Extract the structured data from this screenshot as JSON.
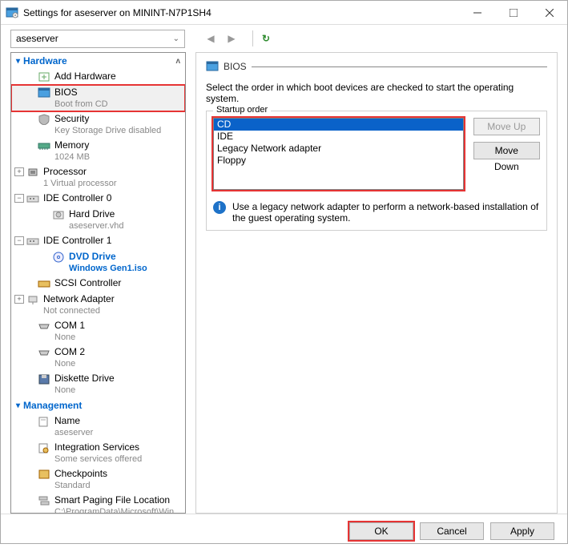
{
  "window": {
    "title": "Settings for aseserver on MININT-N7P1SH4"
  },
  "toolbar": {
    "vm_name": "aseserver"
  },
  "tree": {
    "hardware_label": "Hardware",
    "management_label": "Management",
    "add_hardware": "Add Hardware",
    "bios": {
      "label": "BIOS",
      "sub": "Boot from CD"
    },
    "security": {
      "label": "Security",
      "sub": "Key Storage Drive disabled"
    },
    "memory": {
      "label": "Memory",
      "sub": "1024 MB"
    },
    "processor": {
      "label": "Processor",
      "sub": "1 Virtual processor"
    },
    "ide0": {
      "label": "IDE Controller 0"
    },
    "hard_drive": {
      "label": "Hard Drive",
      "sub": "aseserver.vhd"
    },
    "ide1": {
      "label": "IDE Controller 1"
    },
    "dvd": {
      "label": "DVD Drive",
      "sub": "Windows Gen1.iso"
    },
    "scsi": {
      "label": "SCSI Controller"
    },
    "net": {
      "label": "Network Adapter",
      "sub": "Not connected"
    },
    "com1": {
      "label": "COM 1",
      "sub": "None"
    },
    "com2": {
      "label": "COM 2",
      "sub": "None"
    },
    "diskette": {
      "label": "Diskette Drive",
      "sub": "None"
    },
    "name": {
      "label": "Name",
      "sub": "aseserver"
    },
    "integration": {
      "label": "Integration Services",
      "sub": "Some services offered"
    },
    "checkpoints": {
      "label": "Checkpoints",
      "sub": "Standard"
    },
    "paging": {
      "label": "Smart Paging File Location",
      "sub": "C:\\ProgramData\\Microsoft\\Win..."
    }
  },
  "panel": {
    "title": "BIOS",
    "desc": "Select the order in which boot devices are checked to start the operating system.",
    "startup_label": "Startup order",
    "items": {
      "0": "CD",
      "1": "IDE",
      "2": "Legacy Network adapter",
      "3": "Floppy"
    },
    "move_up": "Move Up",
    "move_down": "Move Down",
    "info": "Use a legacy network adapter to perform a network-based installation of the guest operating system."
  },
  "footer": {
    "ok": "OK",
    "cancel": "Cancel",
    "apply": "Apply"
  }
}
